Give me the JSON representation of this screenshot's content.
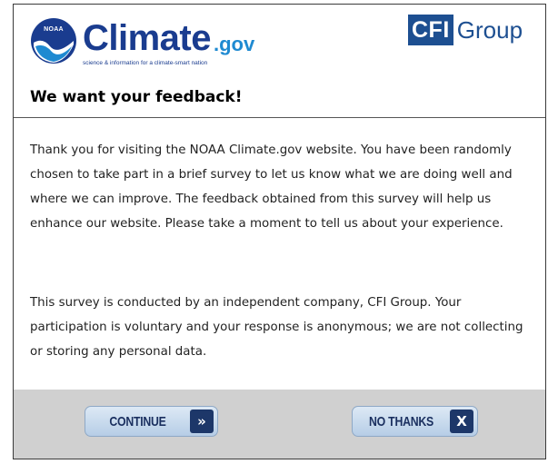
{
  "branding": {
    "noaa_text": "NOAA",
    "climate_text": "Climate",
    "gov_text": ".gov",
    "tagline": "science & information for a climate-smart nation",
    "cfi_box_text": "CFI",
    "cfi_group_text": "Group",
    "colors": {
      "noaa_blue": "#1a3c8f",
      "gov_blue": "#1f8ad1",
      "cfi_blue": "#1d4f91"
    }
  },
  "dialog": {
    "title": "We want your feedback!",
    "paragraph1": "Thank you for visiting the NOAA Climate.gov website. You have been randomly chosen to take part in a brief survey to let us know what we are doing well and where we can improve. The feedback obtained from this survey will help us enhance our website. Please take a moment to tell us about your experience.",
    "paragraph2": "This survey is conducted by an independent company, CFI Group. Your participation is voluntary and your response is anonymous; we are not collecting or storing any personal data."
  },
  "footer": {
    "continue_label": "CONTINUE",
    "continue_icon": "double-chevron-right-icon",
    "continue_glyph": "»",
    "no_thanks_label": "NO THANKS",
    "no_thanks_icon": "close-icon",
    "no_thanks_glyph": "X"
  }
}
